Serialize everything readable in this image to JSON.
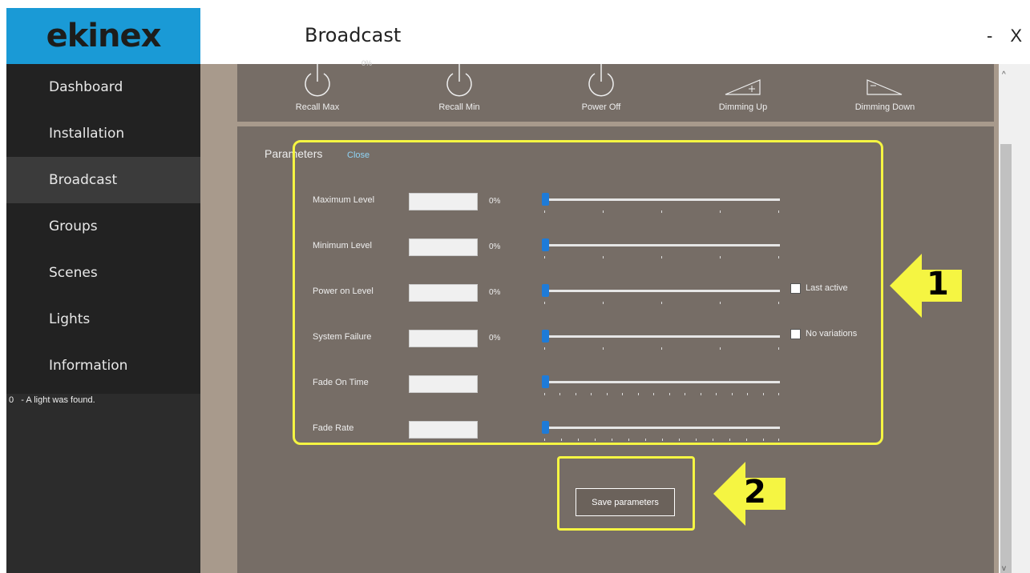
{
  "app": {
    "logo": "ekinex",
    "title": "Broadcast"
  },
  "window_controls": {
    "minimize": "-",
    "close": "X"
  },
  "sidebar": {
    "items": [
      {
        "label": "Dashboard",
        "active": false
      },
      {
        "label": "Installation",
        "active": false
      },
      {
        "label": "Broadcast",
        "active": true
      },
      {
        "label": "Groups",
        "active": false
      },
      {
        "label": "Scenes",
        "active": false
      },
      {
        "label": "Lights",
        "active": false
      },
      {
        "label": "Information",
        "active": false
      }
    ],
    "status": {
      "count": "0",
      "message": "- A light was found."
    }
  },
  "commands": [
    {
      "label": "Recall Max",
      "icon": "power-icon"
    },
    {
      "label": "Recall Min",
      "icon": "power-icon"
    },
    {
      "label": "Power Off",
      "icon": "power-icon"
    },
    {
      "label": "Dimming Up",
      "icon": "dimming-up-icon"
    },
    {
      "label": "Dimming Down",
      "icon": "dimming-down-icon"
    }
  ],
  "cropped_label": "0%",
  "parameters": {
    "title": "Parameters",
    "close_label": "Close",
    "rows": [
      {
        "label": "Maximum Level",
        "value": "",
        "percent": "0%",
        "slider_fraction": 0
      },
      {
        "label": "Minimum Level",
        "value": "",
        "percent": "0%",
        "slider_fraction": 0
      },
      {
        "label": "Power on Level",
        "value": "",
        "percent": "0%",
        "slider_fraction": 0,
        "checkbox": {
          "label": "Last active",
          "checked": false
        }
      },
      {
        "label": "System Failure",
        "value": "",
        "percent": "0%",
        "slider_fraction": 0,
        "checkbox": {
          "label": "No variations",
          "checked": false
        }
      },
      {
        "label": "Fade On Time",
        "value": "",
        "slider_fraction": 0
      },
      {
        "label": "Fade Rate",
        "value": "",
        "slider_fraction": 0
      }
    ],
    "save_label": "Save parameters"
  },
  "callouts": [
    {
      "number": "1"
    },
    {
      "number": "2"
    }
  ],
  "colors": {
    "accent": "#1a9ad6",
    "highlight": "#f5f542",
    "slider": "#1e7bd8",
    "panel": "#766d66",
    "sidebar": "#222222"
  }
}
